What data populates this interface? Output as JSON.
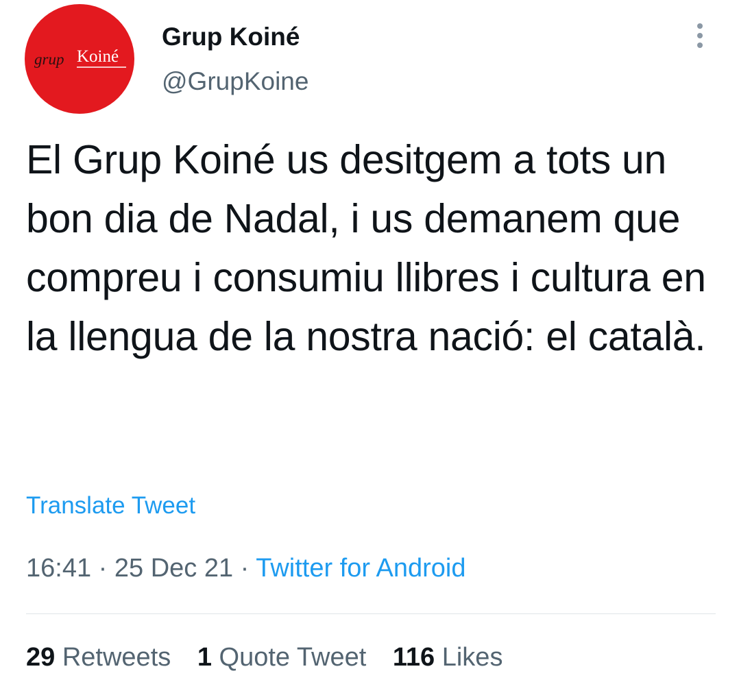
{
  "author": {
    "display_name": "Grup Koiné",
    "handle": "@GrupKoine",
    "avatar_logo": {
      "prefix": "grup",
      "name": "Koiné",
      "background_color": "#e3191f"
    }
  },
  "tweet": {
    "text": "El Grup Koiné us desitgem a tots un bon dia de Nadal, i us demanem que compreu i consumiu llibres i cultura en la llengua de la nostra nació: el català."
  },
  "translate_label": "Translate Tweet",
  "meta": {
    "time": "16:41",
    "separator": "·",
    "date": "25 Dec 21",
    "source": "Twitter for Android"
  },
  "stats": {
    "retweets_count": "29",
    "retweets_label": "Retweets",
    "quotes_count": "1",
    "quotes_label": "Quote Tweet",
    "likes_count": "116",
    "likes_label": "Likes"
  },
  "icons": {
    "more": "more-vertical-icon"
  },
  "colors": {
    "accent": "#1d9bf0",
    "text_primary": "#0f1419",
    "text_secondary": "#536471"
  }
}
